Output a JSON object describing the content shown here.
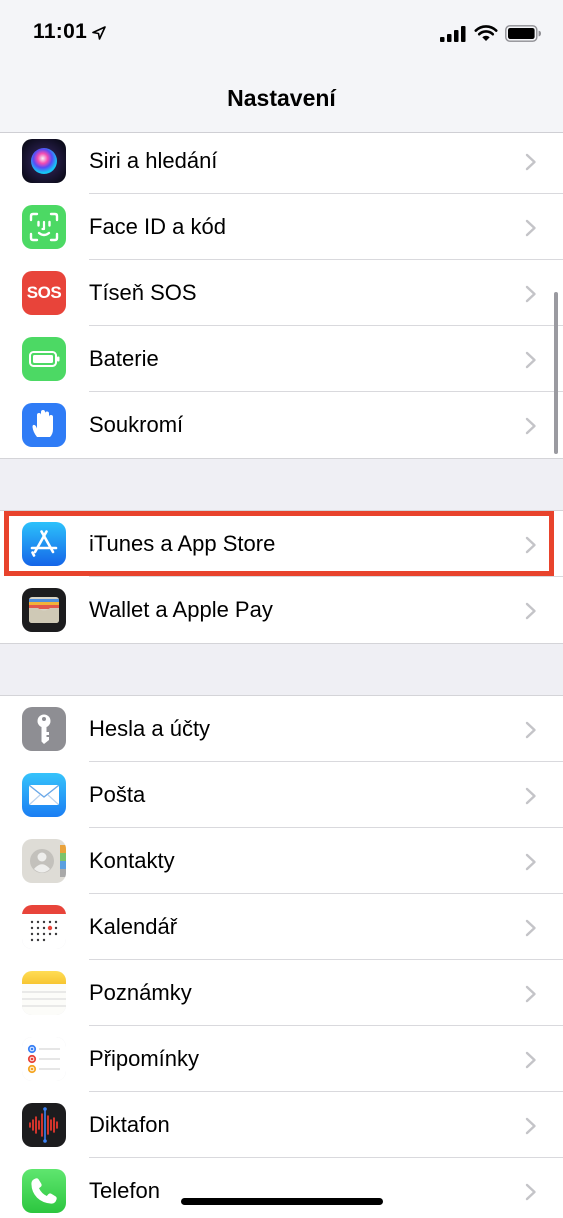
{
  "status_bar": {
    "time": "11:01"
  },
  "header": {
    "title": "Nastavení"
  },
  "groups": [
    {
      "items": [
        {
          "label": "Siri a hledání",
          "icon": "siri-icon"
        },
        {
          "label": "Face ID a kód",
          "icon": "face-id-icon"
        },
        {
          "label": "Tíseň SOS",
          "icon": "sos-icon",
          "icon_text": "SOS"
        },
        {
          "label": "Baterie",
          "icon": "battery-icon"
        },
        {
          "label": "Soukromí",
          "icon": "hand-icon"
        }
      ]
    },
    {
      "items": [
        {
          "label": "iTunes a App Store",
          "icon": "app-store-icon",
          "highlighted": true
        },
        {
          "label": "Wallet a Apple Pay",
          "icon": "wallet-icon"
        }
      ]
    },
    {
      "items": [
        {
          "label": "Hesla a účty",
          "icon": "key-icon"
        },
        {
          "label": "Pošta",
          "icon": "mail-icon"
        },
        {
          "label": "Kontakty",
          "icon": "contacts-icon"
        },
        {
          "label": "Kalendář",
          "icon": "calendar-icon"
        },
        {
          "label": "Poznámky",
          "icon": "notes-icon"
        },
        {
          "label": "Připomínky",
          "icon": "reminders-icon"
        },
        {
          "label": "Diktafon",
          "icon": "voice-memos-icon"
        },
        {
          "label": "Telefon",
          "icon": "phone-icon"
        }
      ]
    }
  ],
  "colors": {
    "highlight_border": "#e8432c",
    "background": "#efeff4",
    "chevron": "#c4c4c8"
  }
}
